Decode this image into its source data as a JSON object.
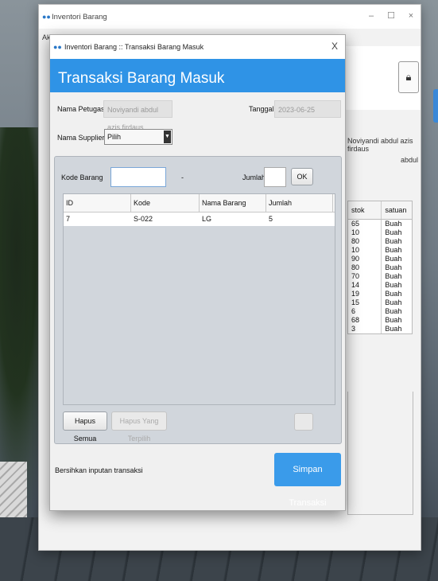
{
  "main_window": {
    "title": "Inventori Barang",
    "menu_first": "Akt",
    "user_name": "Noviyandi abdul azis firdaus",
    "user_short": "abdul",
    "stock_table": {
      "headers": [
        "stok",
        "satuan"
      ],
      "rows": [
        [
          "65",
          "Buah"
        ],
        [
          "10",
          "Buah"
        ],
        [
          "80",
          "Buah"
        ],
        [
          "10",
          "Buah"
        ],
        [
          "90",
          "Buah"
        ],
        [
          "80",
          "Buah"
        ],
        [
          "70",
          "Buah"
        ],
        [
          "14",
          "Buah"
        ],
        [
          "19",
          "Buah"
        ],
        [
          "15",
          "Buah"
        ],
        [
          "6",
          "Buah"
        ],
        [
          "68",
          "Buah"
        ],
        [
          "3",
          "Buah"
        ]
      ]
    }
  },
  "dialog": {
    "title": "Inventori Barang :: Transaksi Barang Masuk",
    "header": "Transaksi Barang Masuk",
    "nama_petugas_label": "Nama Petugas",
    "nama_petugas_value": "Noviyandi abdul azis firdaus",
    "tanggal_label": "Tanggal",
    "tanggal_value": "2023-06-25",
    "nama_supplier_label": "Nama Supplier",
    "supplier_selected": "Pilih",
    "kode_barang_label": "Kode Barang",
    "kode_barang_value": "",
    "separator": "-",
    "jumlah_label": "Jumlah",
    "jumlah_value": "",
    "ok_label": "OK",
    "table": {
      "headers": [
        "ID",
        "Kode",
        "Nama Barang",
        "Jumlah"
      ],
      "rows": [
        [
          "7",
          "S-022",
          "LG",
          "5"
        ]
      ]
    },
    "hapus_semua": "Hapus Semua",
    "hapus_terpilih": "Hapus Yang Terpilih",
    "bersihkan": "Bersihkan inputan transaksi",
    "simpan": "Simpan Transaksi"
  }
}
